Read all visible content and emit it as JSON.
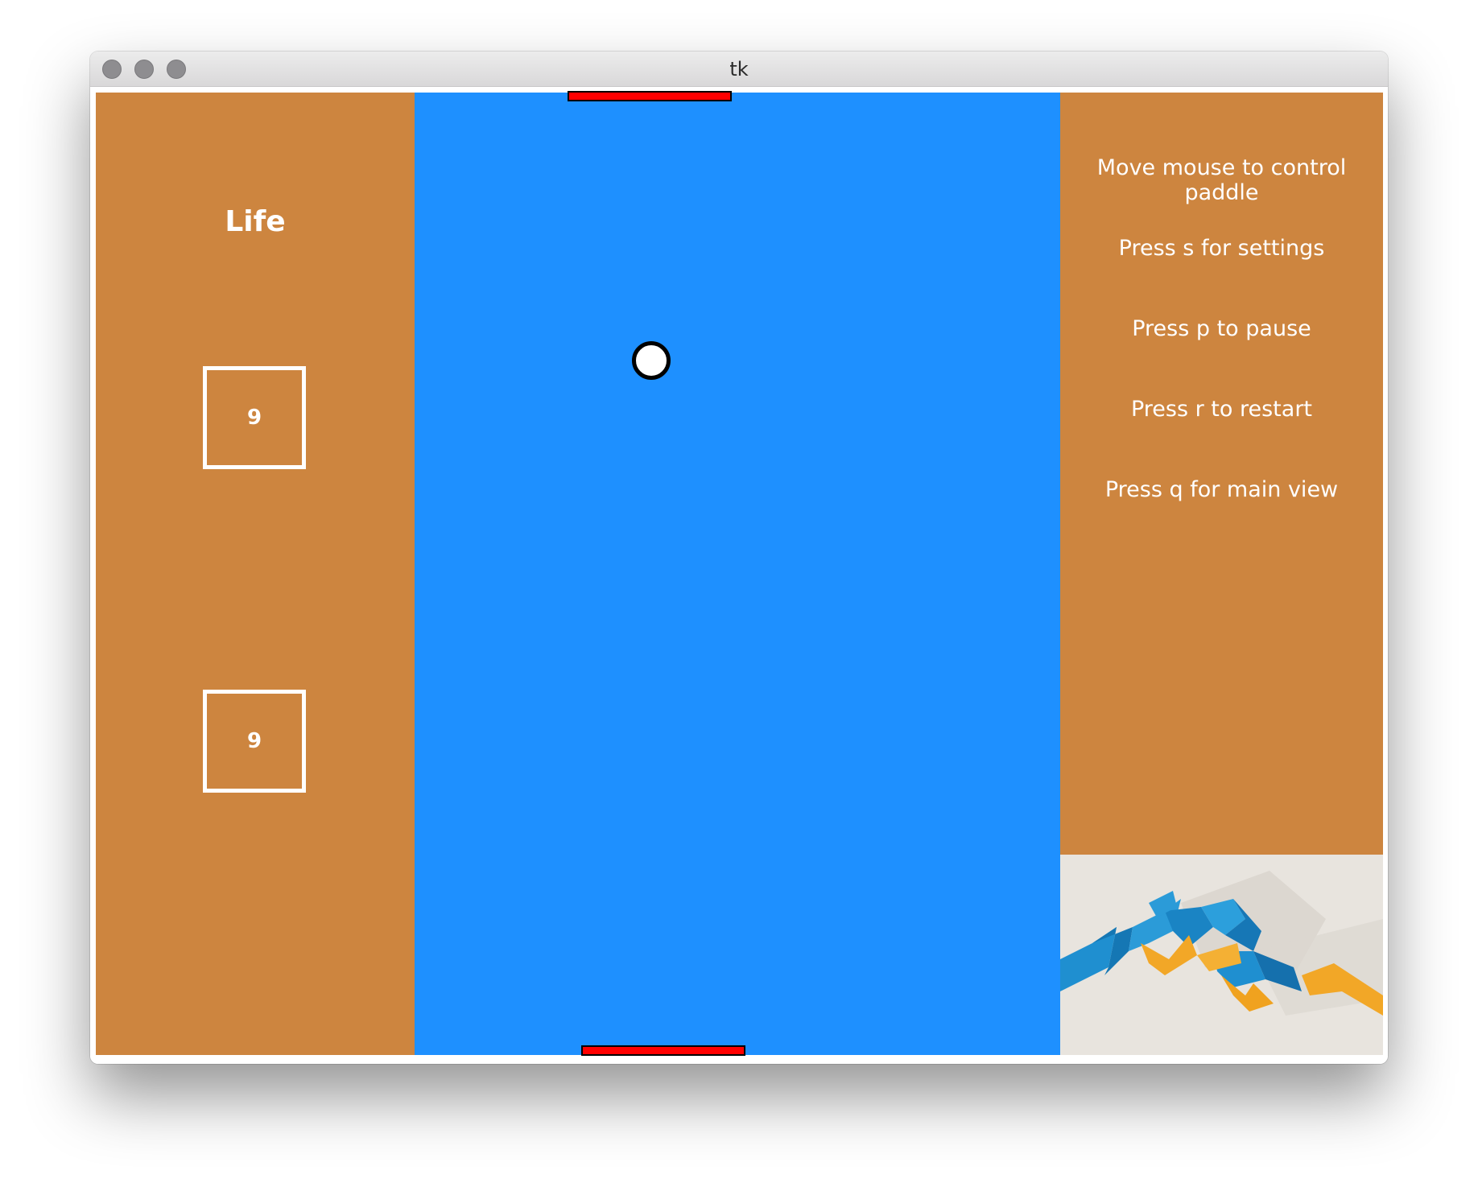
{
  "window": {
    "title": "tk"
  },
  "left_panel": {
    "heading": "Life",
    "lives": [
      "9",
      "9"
    ]
  },
  "right_panel": {
    "hints": [
      "Move mouse to control paddle",
      "Press s for settings",
      "Press p to pause",
      "Press r to restart",
      "Press q for main view"
    ]
  },
  "colors": {
    "panel": "#cd853f",
    "field": "#1e90ff",
    "paddle": "#ff0000",
    "ball": "#ffffff"
  }
}
